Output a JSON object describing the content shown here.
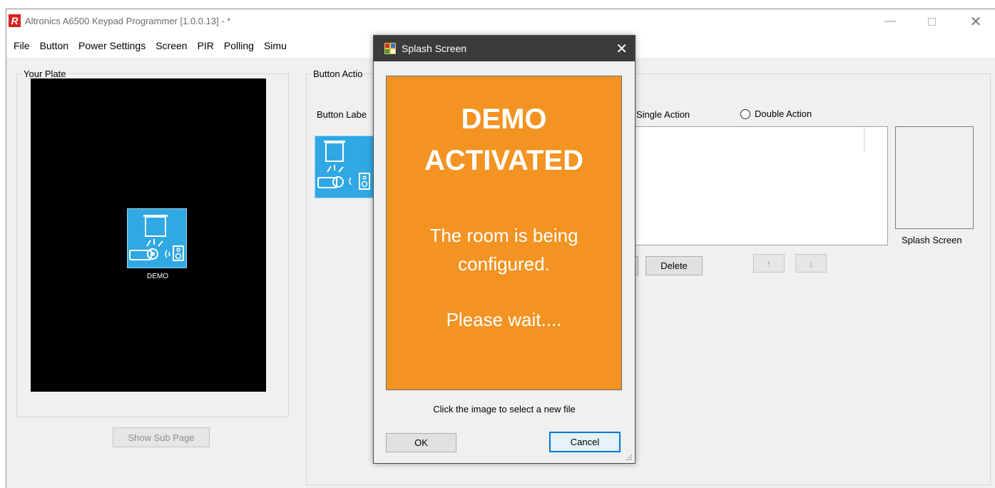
{
  "window": {
    "title": "Altronics A6500 Keypad Programmer [1.0.0.13]  - *",
    "logo_letter": "R",
    "controls": {
      "minimize": "—",
      "close": "✕"
    }
  },
  "menu": {
    "items": [
      "File",
      "Button",
      "Power Settings",
      "Screen",
      "PIR",
      "Polling",
      "Simu"
    ]
  },
  "plate": {
    "legend": "Your Plate",
    "tile_caption": "DEMO",
    "show_sub_page_label": "Show Sub Page"
  },
  "button_actions": {
    "legend": "Button Actio",
    "button_label_text": "Button Labe",
    "single_action_label": "Single Action",
    "double_action_label": "Double Action",
    "delete_label": "Delete",
    "up_label": "↑",
    "down_label": "↓",
    "splash_screen_label": "Splash Screen"
  },
  "dialog": {
    "title": "Splash Screen",
    "close": "✕",
    "splash": {
      "line1": "DEMO",
      "line2": "ACTIVATED",
      "line3": "The room is being",
      "line4": "configured.",
      "line5": "Please wait...."
    },
    "hint": "Click the image to select a new file",
    "ok_label": "OK",
    "cancel_label": "Cancel"
  },
  "colors": {
    "splash_background": "#f39322",
    "tile_blue": "#30a8e4",
    "accent": "#0078d7",
    "dialog_titlebar": "#3b3b3b"
  }
}
